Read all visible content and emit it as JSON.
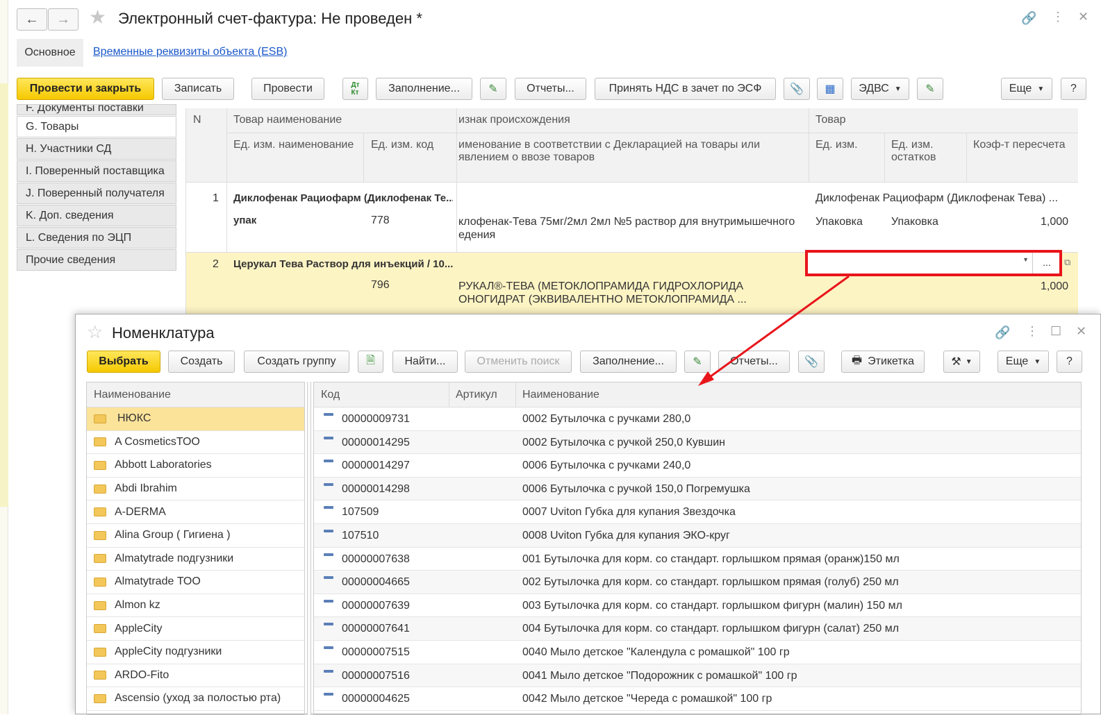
{
  "window": {
    "title": "Электронный счет-фактура:  Не проведен *",
    "tabs": [
      "Основное",
      "Временные реквизиты объекта (ESB)"
    ]
  },
  "toolbar": {
    "post_close": "Провести и закрыть",
    "save": "Записать",
    "post": "Провести",
    "fill": "Заполнение...",
    "reports": "Отчеты...",
    "accept_vat": "Принять НДС в зачет по ЭСФ",
    "edvs": "ЭДВС",
    "more": "Еще",
    "help": "?"
  },
  "sidebar": {
    "items": [
      "F. Документы поставки",
      "G. Товары",
      "H. Участники СД",
      "I. Поверенный поставщика",
      "J. Поверенный получателя",
      "K. Доп. сведения",
      "L. Сведения по ЭЦП",
      "Прочие сведения"
    ]
  },
  "goods_table": {
    "headers": {
      "n": "N",
      "name": "Товар наименование",
      "unit_name": "Ед. изм. наименование",
      "unit_code": "Ед. изм. код",
      "origin": "изнак происхождения",
      "decl_name": "именование в соответствии с Декларацией  на товары или",
      "decl_name2": "явлением о ввозе товаров",
      "goods": "Товар",
      "unit": "Ед. изм.",
      "stock_unit": "Ед. изм.",
      "stock_unit2": "остатков",
      "coef": "Коэф-т пересчета"
    },
    "rows": [
      {
        "n": "1",
        "name": "Диклофенак Рациофарм (Диклофенак Те...",
        "unit_name": "упак",
        "unit_code": "778",
        "decl1": "клофенак-Тева 75мг/2мл 2мл №5 раствор для внутримышечного",
        "decl2": "едения",
        "goods": "Диклофенак Рациофарм (Диклофенак Тева) ...",
        "unit": "Упаковка",
        "stock_unit": "Упаковка",
        "coef": "1,000"
      },
      {
        "n": "2",
        "name": "Церукал Тева Раствор для инъекций / 10...",
        "unit_name": "",
        "unit_code": "796",
        "decl1": "РУКАЛ®-ТЕВА (МЕТОКЛОПРАМИДА ГИДРОХЛОРИДА",
        "decl2": "ОНОГИДРАТ (ЭКВИВАЛЕНТНО МЕТОКЛОПРАМИДА ...",
        "goods": "",
        "unit": "",
        "stock_unit": "",
        "coef": "1,000"
      }
    ]
  },
  "popup": {
    "title": "Номенклатура",
    "buttons": {
      "select": "Выбрать",
      "create": "Создать",
      "create_group": "Создать группу",
      "find": "Найти...",
      "cancel_search": "Отменить поиск",
      "fill": "Заполнение...",
      "reports": "Отчеты...",
      "label": "Этикетка",
      "more": "Еще",
      "help": "?"
    },
    "tree": {
      "header": "Наименование",
      "items": [
        "НЮКС",
        "A CosmeticsТОО",
        "Abbott Laboratories",
        "Abdi Ibrahim",
        "A-DERMA",
        "Alina Group ( Гигиена )",
        "Almatytrade подгузники",
        "Almatytrade ТОО",
        "Almon kz",
        "AppleCity",
        "AppleCity подгузники",
        "ARDO-Fito",
        "Ascensio (уход за полостью рта)"
      ]
    },
    "list": {
      "headers": {
        "code": "Код",
        "article": "Артикул",
        "name": "Наименование"
      },
      "rows": [
        {
          "code": "00000009731",
          "name": "0002 Бутылочка с ручками 280,0"
        },
        {
          "code": "00000014295",
          "name": "0002 Бутылочка с ручкой 250,0 Кувшин"
        },
        {
          "code": "00000014297",
          "name": "0006 Бутылочка с ручками 240,0"
        },
        {
          "code": "00000014298",
          "name": "0006 Бутылочка с ручкой 150,0 Погремушка"
        },
        {
          "code": "107509",
          "name": "0007 Uviton Губка для купания Звездочка"
        },
        {
          "code": "107510",
          "name": "0008 Uviton Губка для купания ЭКО-круг"
        },
        {
          "code": "00000007638",
          "name": "001 Бутылочка для корм. со стандарт. горлышком прямая (оранж)150 мл"
        },
        {
          "code": "00000004665",
          "name": "002 Бутылочка для корм. со стандарт. горлышком прямая (голуб) 250 мл"
        },
        {
          "code": "00000007639",
          "name": "003 Бутылочка для корм. со стандарт. горлышком фигурн  (малин) 150 мл"
        },
        {
          "code": "00000007641",
          "name": "004 Бутылочка для корм. со стандарт. горлышком фигурн  (салат) 250 мл"
        },
        {
          "code": "00000007515",
          "name": "0040 Мыло детское \"Календула с ромашкой\" 100 гр"
        },
        {
          "code": "00000007516",
          "name": "0041 Мыло детское \"Подорожник с ромашкой\" 100 гр"
        },
        {
          "code": "00000004625",
          "name": "0042 Мыло детское \"Череда с ромашкой\" 100 гр"
        }
      ]
    }
  },
  "colors": {
    "accent_yellow": "#f5c800",
    "highlight_red": "#e8151b",
    "selected_row": "#fbe39a"
  }
}
